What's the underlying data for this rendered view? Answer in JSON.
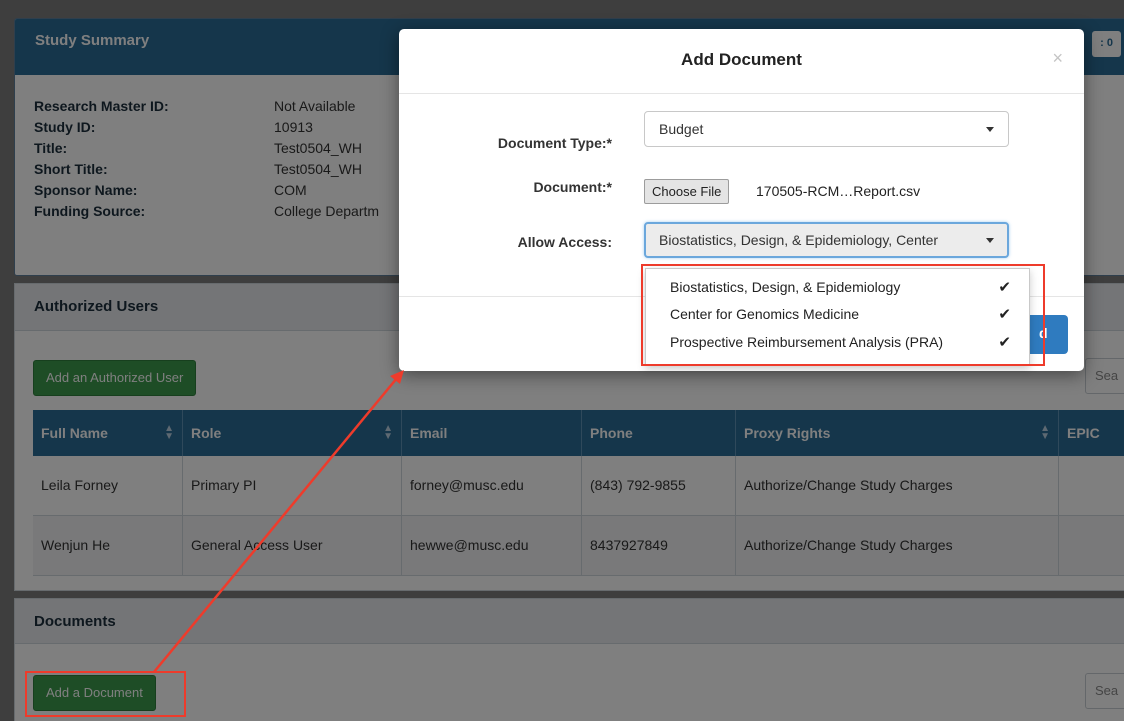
{
  "study_summary": {
    "title": "Study Summary",
    "top_right_fragment": ": 0",
    "fields": [
      {
        "label": "Research Master ID:",
        "value": "Not Available"
      },
      {
        "label": "Study ID:",
        "value": "10913"
      },
      {
        "label": "Title:",
        "value": "Test0504_WH"
      },
      {
        "label": "Short Title:",
        "value": "Test0504_WH"
      },
      {
        "label": "Sponsor Name:",
        "value": "COM"
      },
      {
        "label": "Funding Source:",
        "value": "College Departm"
      }
    ]
  },
  "authorized_users": {
    "title": "Authorized Users",
    "add_button": "Add an Authorized User",
    "search_fragment": "Sea",
    "columns": [
      "Full Name",
      "Role",
      "Email",
      "Phone",
      "Proxy Rights",
      "EPIC"
    ],
    "rows": [
      {
        "full_name": "Leila Forney",
        "role": "Primary PI",
        "email": "forney@musc.edu",
        "phone": "(843) 792-9855",
        "proxy_rights": "Authorize/Change Study Charges"
      },
      {
        "full_name": "Wenjun He",
        "role": "General Access User",
        "email": "hewwe@musc.edu",
        "phone": "8437927849",
        "proxy_rights": "Authorize/Change Study Charges"
      }
    ]
  },
  "documents": {
    "title": "Documents",
    "add_button": "Add a Document",
    "search_fragment": "Sea"
  },
  "modal": {
    "title": "Add Document",
    "close_glyph": "×",
    "document_type_label": "Document Type:*",
    "document_type_value": "Budget",
    "document_label": "Document:*",
    "choose_file_label": "Choose File",
    "file_name": "170505-RCM…Report.csv",
    "allow_access_label": "Allow Access:",
    "allow_access_value": "Biostatistics, Design, & Epidemiology, Center",
    "footer_button_fragment": "d",
    "access_options": [
      {
        "label": "Biostatistics, Design, & Epidemiology",
        "checked": true
      },
      {
        "label": "Center for Genomics Medicine",
        "checked": true
      },
      {
        "label": "Prospective Reimbursement Analysis (PRA)",
        "checked": true
      }
    ],
    "check_glyph": "✔"
  },
  "icons": {
    "sort": "sort-arrows-icon",
    "caret": "caret-down-icon",
    "check": "checkmark-icon"
  },
  "colors": {
    "header_blue": "#2b6c97",
    "green": "#3d9a4d",
    "annotation_red": "#ee3b2b",
    "primary_blue": "#2f7bbf"
  }
}
